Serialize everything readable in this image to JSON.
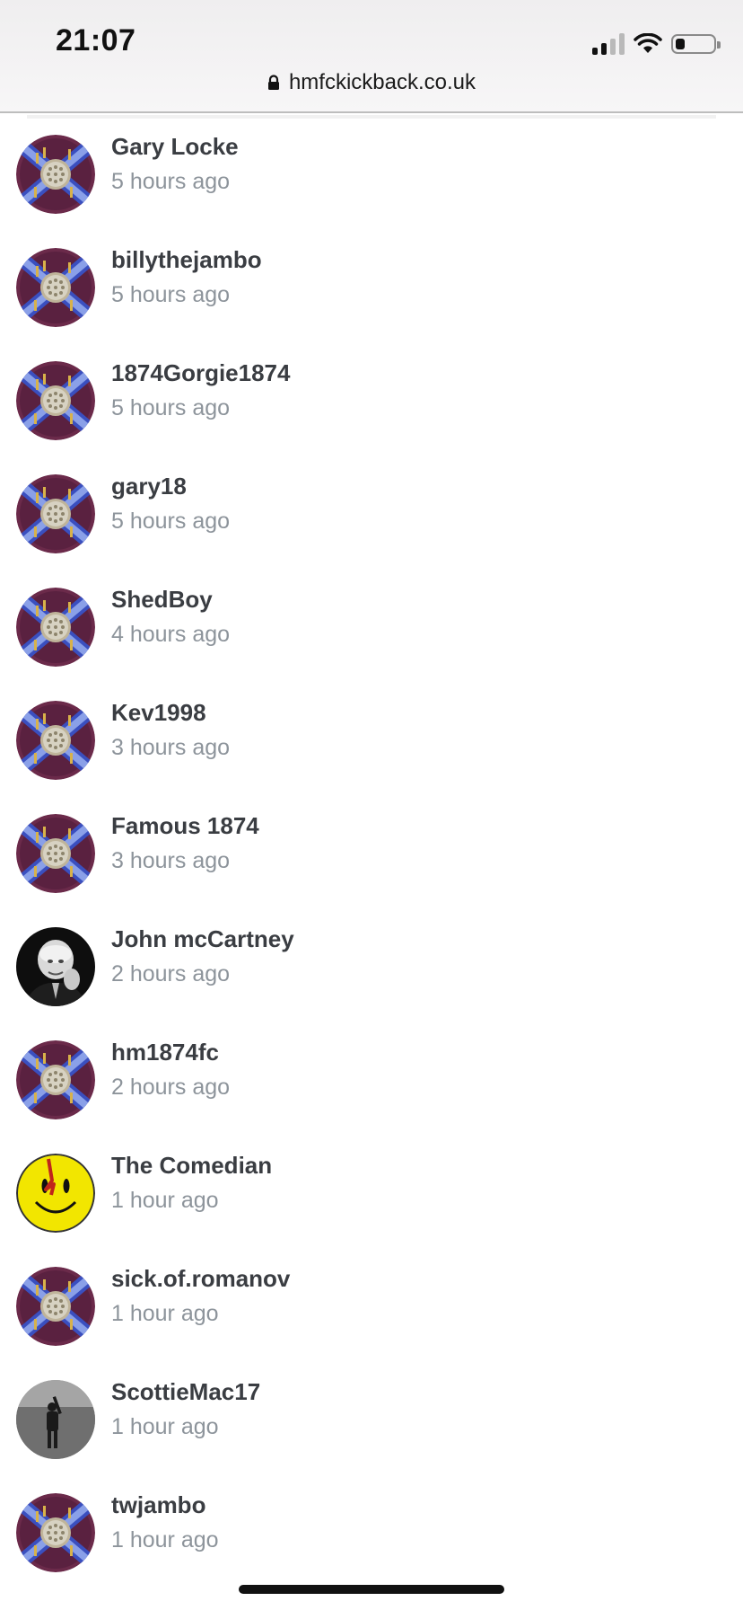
{
  "status_bar": {
    "time": "21:07",
    "signal_bars_active": 2,
    "signal_bars_total": 4,
    "battery_level": 0.25,
    "icons": [
      "cellular-signal-icon",
      "wifi-icon",
      "battery-icon"
    ]
  },
  "address_bar": {
    "url": "hmfckickback.co.uk",
    "icon": "lock-icon"
  },
  "members": [
    {
      "name": "Gary Locke",
      "time": "5 hours ago",
      "avatar": "hmfc-crest"
    },
    {
      "name": "billythejambo",
      "time": "5 hours ago",
      "avatar": "hmfc-crest"
    },
    {
      "name": "1874Gorgie1874",
      "time": "5 hours ago",
      "avatar": "hmfc-crest"
    },
    {
      "name": "gary18",
      "time": "5 hours ago",
      "avatar": "hmfc-crest"
    },
    {
      "name": "ShedBoy",
      "time": "4 hours ago",
      "avatar": "hmfc-crest"
    },
    {
      "name": "Kev1998",
      "time": "3 hours ago",
      "avatar": "hmfc-crest"
    },
    {
      "name": "Famous 1874",
      "time": "3 hours ago",
      "avatar": "hmfc-crest"
    },
    {
      "name": "John mcCartney",
      "time": "2 hours ago",
      "avatar": "bw-portrait"
    },
    {
      "name": "hm1874fc",
      "time": "2 hours ago",
      "avatar": "hmfc-crest"
    },
    {
      "name": "The Comedian",
      "time": "1 hour ago",
      "avatar": "smiley-face"
    },
    {
      "name": "sick.of.romanov",
      "time": "1 hour ago",
      "avatar": "hmfc-crest"
    },
    {
      "name": "ScottieMac17",
      "time": "1 hour ago",
      "avatar": "bw-field-photo"
    },
    {
      "name": "twjambo",
      "time": "1 hour ago",
      "avatar": "hmfc-crest"
    }
  ],
  "colors": {
    "name_text": "#3a3d42",
    "time_text": "#8d949b",
    "crest_maroon": "#6b2a4a",
    "crest_blue": "#3a4fbf",
    "smiley_yellow": "#f2e600"
  }
}
